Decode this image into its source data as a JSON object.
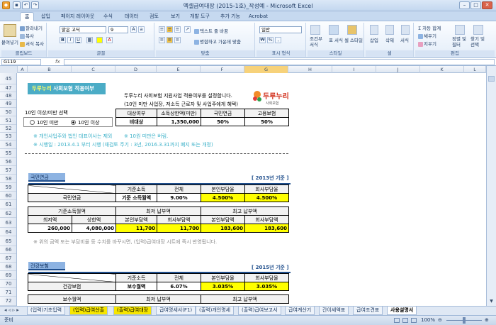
{
  "window": {
    "title": "엑셀급여대장 (2015-1호)_작성예 - Microsoft Excel",
    "min": "–",
    "max": "□",
    "close": "✕"
  },
  "ribbon_tabs": [
    "홈",
    "삽입",
    "페이지 레이아웃",
    "수식",
    "데이터",
    "검토",
    "보기",
    "개발 도구",
    "추가 기능",
    "Acrobat"
  ],
  "ribbon": {
    "paste": "붙여넣기",
    "cut": "잘라내기",
    "copy": "복사",
    "format_painter": "서식 복사",
    "font_name": "맑은 고딕",
    "font_size": "9",
    "wrap_text": "텍스트 줄 바꿈",
    "merge_center": "병합하고 가운데 맞춤",
    "number_format": "일반",
    "conditional_format": "조건부 서식",
    "format_table": "표 서식",
    "cell_styles": "셀 스타일",
    "insert": "삽입",
    "delete": "삭제",
    "format": "서식",
    "autosum": "자동 합계",
    "fill": "채우기",
    "clear": "지우기",
    "sort_filter": "정렬 및 필터",
    "find_select": "찾기 및 선택",
    "groups": [
      "클립보드",
      "글꼴",
      "맞춤",
      "표시 형식",
      "스타일",
      "셀",
      "편집"
    ]
  },
  "formula_bar": {
    "name_box": "G119",
    "fx": "fx"
  },
  "columns": [
    "A",
    "B",
    "C",
    "D",
    "E",
    "F",
    "G",
    "H",
    "I",
    "J",
    "K",
    "L"
  ],
  "rows": [
    "45",
    "47",
    "48",
    "49",
    "50",
    "51",
    "52",
    "53",
    "54",
    "55",
    "56",
    "57",
    "58",
    "59",
    "60",
    "61",
    "62",
    "63",
    "64",
    "65",
    "66",
    "67",
    "68",
    "69",
    "70",
    "71",
    "72",
    "73",
    "74"
  ],
  "social": {
    "title_pre": "두루누리",
    "title_post": " 사회보험 적용여부",
    "desc1": "두루누리 사회보험 지원사업 적용여부를 설정합니다.",
    "desc2": "(10인 미만 사업장, 저소득 근로자 및 사업주에게 혜택)",
    "logo": "두루누리",
    "logo_sub": "사회보험",
    "option_title": "10인 이상/미만 선택",
    "option_under": "10인 미만",
    "option_over": "10인 이상",
    "note1": "※ 개인사업주와 법인 대표이사는 제외",
    "note1b": "※ 10원 미만은 버림.",
    "note2": "※ 시행일 : 2013.4.1 부터 시행 (재검토 주기 : 3년, 2016.3.31까지 폐지 또는 개정)",
    "table_header": [
      "대상여부",
      "소득상한액(미만)",
      "국민연금",
      "고용보험"
    ],
    "table_row": [
      "비대상",
      "1,350,000",
      "50%",
      "50%"
    ]
  },
  "pension": {
    "title": "국민연금",
    "year": "[ 2013년 기준 ]",
    "h1": [
      "기준소득",
      "전체",
      "본인부담율",
      "회사부담율"
    ],
    "r1": [
      "국민연금",
      "기준 소득월액",
      "9.00%",
      "4.500%",
      "4.500%"
    ],
    "h2a": [
      "기준소득월액",
      "최저 납부액",
      "최고 납부액"
    ],
    "h2b": [
      "최저액",
      "상한액",
      "본인부담액",
      "회사부담액",
      "본인부담액",
      "회사부담액"
    ],
    "r2": [
      "260,000",
      "4,080,000",
      "11,700",
      "11,700",
      "183,600",
      "183,600"
    ],
    "note": "※ 위의 금액 또는 부담비율 등 수치를 바꾸시면, (입력)급여대장 시트에 즉시 반영됩니다."
  },
  "health": {
    "title": "건강보험",
    "year": "[ 2015년 기준 ]",
    "h1": [
      "기준소득",
      "전체",
      "본인부담율",
      "회사부담율"
    ],
    "r1": [
      "건강보험",
      "보수월액",
      "6.07%",
      "3.035%",
      "3.035%"
    ],
    "h2a": [
      "보수월액",
      "최저 납부액",
      "최고 납부액"
    ]
  },
  "sheets": [
    "(입력)기초입력",
    "(입력)급여산출",
    "(출력)급여대장",
    "급여명세서(F1)",
    "(출력)개인명세",
    "(출력)급여보고서",
    "급여계산기",
    "간이세액표",
    "급여조견표",
    "사용설명서"
  ],
  "status": {
    "mode": "준비",
    "zoom": "100%"
  }
}
